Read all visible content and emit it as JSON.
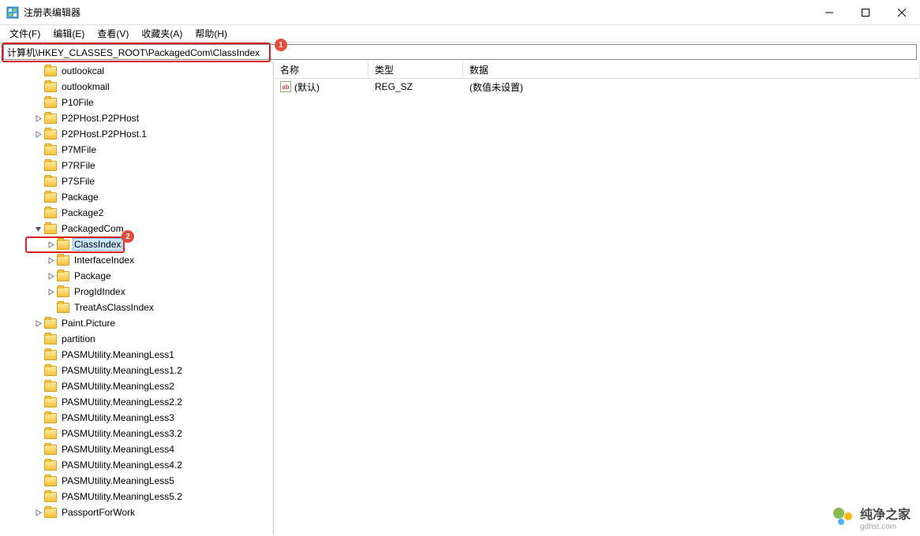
{
  "window": {
    "title": "注册表编辑器"
  },
  "menu": {
    "file": "文件(F)",
    "edit": "编辑(E)",
    "view": "查看(V)",
    "favorites": "收藏夹(A)",
    "help": "帮助(H)"
  },
  "address": {
    "path": "计算机\\HKEY_CLASSES_ROOT\\PackagedCom\\ClassIndex"
  },
  "callouts": {
    "one": "1",
    "two": "2"
  },
  "tree": [
    {
      "indent": 2,
      "expander": "none",
      "label": "outlookcal"
    },
    {
      "indent": 2,
      "expander": "none",
      "label": "outlookmail"
    },
    {
      "indent": 2,
      "expander": "none",
      "label": "P10File"
    },
    {
      "indent": 2,
      "expander": "closed",
      "label": "P2PHost.P2PHost"
    },
    {
      "indent": 2,
      "expander": "closed",
      "label": "P2PHost.P2PHost.1"
    },
    {
      "indent": 2,
      "expander": "none",
      "label": "P7MFile"
    },
    {
      "indent": 2,
      "expander": "none",
      "label": "P7RFile"
    },
    {
      "indent": 2,
      "expander": "none",
      "label": "P7SFile"
    },
    {
      "indent": 2,
      "expander": "none",
      "label": "Package"
    },
    {
      "indent": 2,
      "expander": "none",
      "label": "Package2"
    },
    {
      "indent": 2,
      "expander": "open",
      "label": "PackagedCom"
    },
    {
      "indent": 3,
      "expander": "closed",
      "label": "ClassIndex",
      "selected": true
    },
    {
      "indent": 3,
      "expander": "closed",
      "label": "InterfaceIndex"
    },
    {
      "indent": 3,
      "expander": "closed",
      "label": "Package"
    },
    {
      "indent": 3,
      "expander": "closed",
      "label": "ProgIdIndex"
    },
    {
      "indent": 3,
      "expander": "none",
      "label": "TreatAsClassIndex"
    },
    {
      "indent": 2,
      "expander": "closed",
      "label": "Paint.Picture"
    },
    {
      "indent": 2,
      "expander": "none",
      "label": "partition"
    },
    {
      "indent": 2,
      "expander": "none",
      "label": "PASMUtility.MeaningLess1"
    },
    {
      "indent": 2,
      "expander": "none",
      "label": "PASMUtility.MeaningLess1.2"
    },
    {
      "indent": 2,
      "expander": "none",
      "label": "PASMUtility.MeaningLess2"
    },
    {
      "indent": 2,
      "expander": "none",
      "label": "PASMUtility.MeaningLess2.2"
    },
    {
      "indent": 2,
      "expander": "none",
      "label": "PASMUtility.MeaningLess3"
    },
    {
      "indent": 2,
      "expander": "none",
      "label": "PASMUtility.MeaningLess3.2"
    },
    {
      "indent": 2,
      "expander": "none",
      "label": "PASMUtility.MeaningLess4"
    },
    {
      "indent": 2,
      "expander": "none",
      "label": "PASMUtility.MeaningLess4.2"
    },
    {
      "indent": 2,
      "expander": "none",
      "label": "PASMUtility.MeaningLess5"
    },
    {
      "indent": 2,
      "expander": "none",
      "label": "PASMUtility.MeaningLess5.2"
    },
    {
      "indent": 2,
      "expander": "closed",
      "label": "PassportForWork"
    }
  ],
  "list": {
    "columns": {
      "name": "名称",
      "type": "类型",
      "data": "数据"
    },
    "rows": [
      {
        "name": "(默认)",
        "type": "REG_SZ",
        "data": "(数值未设置)"
      }
    ]
  },
  "watermark": {
    "text": "纯净之家",
    "sub": "gdhst.com"
  }
}
